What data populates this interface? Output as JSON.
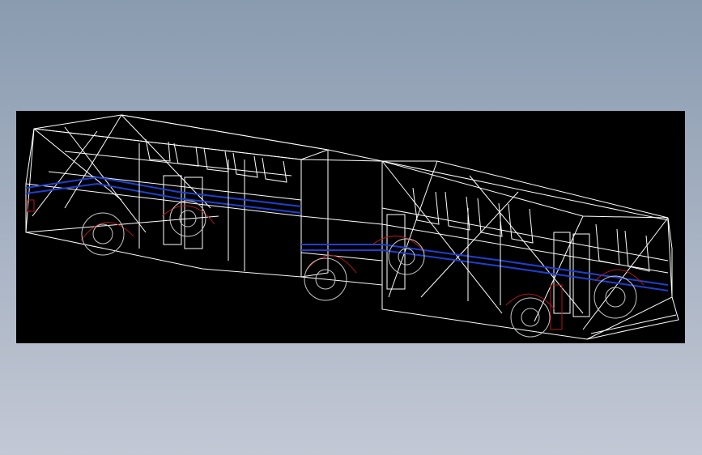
{
  "app": {
    "background_top": "#8a9bb0",
    "background_bottom": "#c3c8d5"
  },
  "viewport": {
    "background": "#000000",
    "render_mode": "wireframe"
  },
  "model": {
    "subject": "articulated-bus",
    "line_colors": {
      "edges": "#ffffff",
      "stripe": "#1f3fd0",
      "wheel_arches": "#b01818",
      "wheels": "#c8c8c8"
    }
  }
}
